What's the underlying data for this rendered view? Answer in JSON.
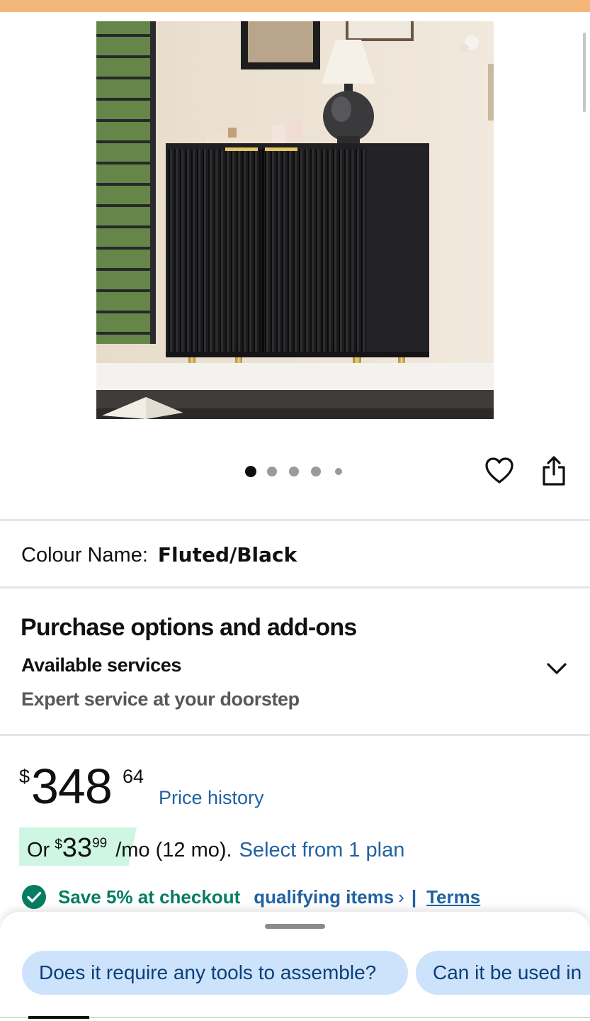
{
  "gallery": {
    "image_alt": "Fluted black accent cabinet with gold legs",
    "dot_count": 5,
    "active_dot": 1
  },
  "actions": {
    "wishlist_icon": "heart-outline-icon",
    "share_icon": "share-icon"
  },
  "variation": {
    "label": "Colour Name:",
    "value": "Fluted/Black"
  },
  "purchase_options": {
    "title": "Purchase options and add-ons",
    "subtitle": "Available services",
    "description": "Expert service at your doorstep",
    "toggle_icon": "chevron-down-icon"
  },
  "price": {
    "symbol": "$",
    "whole": "348",
    "fraction": "64",
    "history_link": "Price history"
  },
  "monthly": {
    "prefix": "Or",
    "symbol": "$",
    "whole": "33",
    "fraction": "99",
    "suffix": "/mo (12 mo).",
    "link": "Select from 1 plan",
    "badge_color": "#cff5e3"
  },
  "promo": {
    "icon": "checkmark-circle-icon",
    "save_text": "Save 5% at checkout",
    "qualify_link": "qualifying items",
    "chevron": "›",
    "separator": "|",
    "terms": "Terms"
  },
  "bottom_sheet": {
    "chips": [
      {
        "label": "Does it require any tools to assemble?"
      },
      {
        "label": "Can it be used in"
      }
    ]
  },
  "colors": {
    "link": "#2162a1",
    "success": "#067d62",
    "top_bar": "#f3b77a",
    "chip": "#cde3fb"
  }
}
